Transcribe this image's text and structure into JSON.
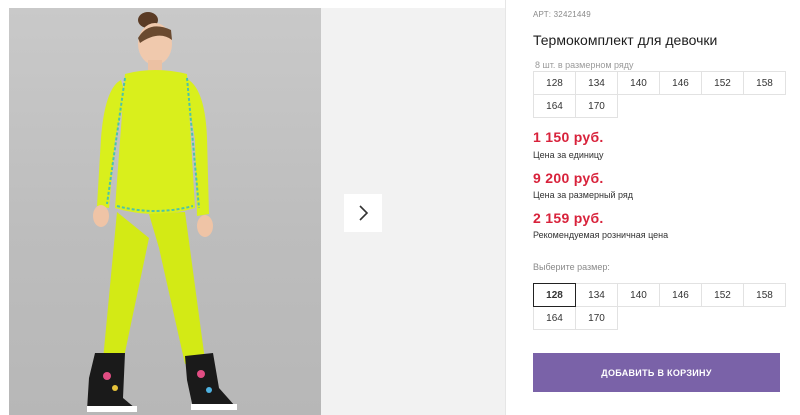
{
  "product": {
    "article": "АРТ: 32421449",
    "title": "Термокомплект для девочки",
    "row_note": "8 шт. в размерном ряду"
  },
  "size_row": [
    "128",
    "134",
    "140",
    "146",
    "152",
    "158",
    "164",
    "170"
  ],
  "prices": [
    {
      "amount": "1 150 руб.",
      "note": "Цена за единицу"
    },
    {
      "amount": "9 200 руб.",
      "note": "Цена за размерный ряд"
    },
    {
      "amount": "2 159 руб.",
      "note": "Рекомендуемая розничная цена"
    }
  ],
  "select": {
    "label": "Выберите размер:",
    "sizes": [
      "128",
      "134",
      "140",
      "146",
      "152",
      "158",
      "164",
      "170"
    ],
    "selected": "128"
  },
  "cart": {
    "button_label": "ДОБАВИТЬ В КОРЗИНУ"
  },
  "gallery": {
    "next_icon": "chevron-right-icon",
    "photo_subject": "girl in lime thermal set and black boots"
  },
  "colors": {
    "price": "#d8223b",
    "button": "#7a62a8",
    "lime": "#d9ef1c"
  }
}
